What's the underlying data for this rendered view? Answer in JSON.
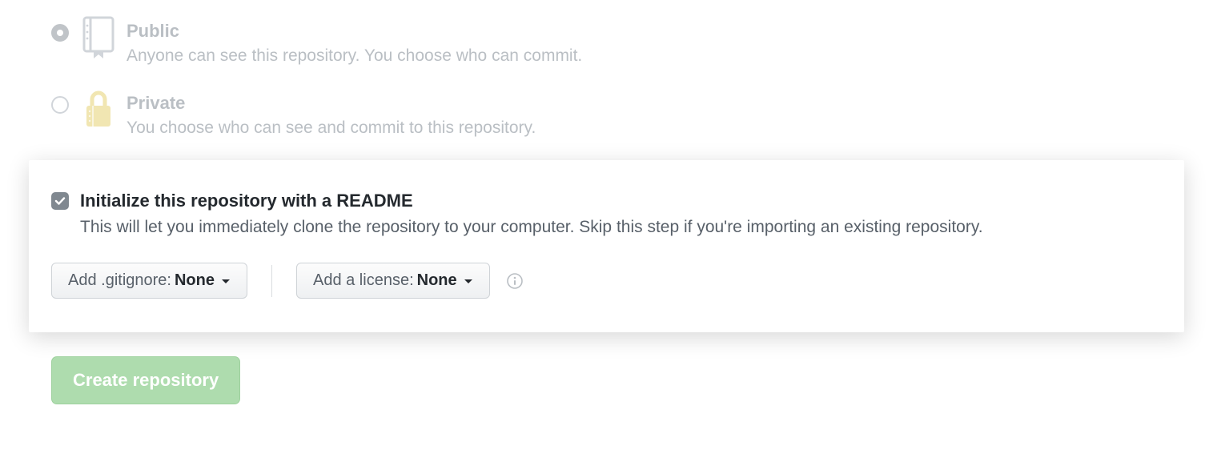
{
  "visibility": {
    "public": {
      "title": "Public",
      "desc": "Anyone can see this repository. You choose who can commit."
    },
    "private": {
      "title": "Private",
      "desc": "You choose who can see and commit to this repository."
    }
  },
  "readme": {
    "title": "Initialize this repository with a README",
    "desc": "This will let you immediately clone the repository to your computer. Skip this step if you're importing an existing repository."
  },
  "gitignore": {
    "label": "Add .gitignore:",
    "value": "None"
  },
  "license": {
    "label": "Add a license:",
    "value": "None"
  },
  "submit": {
    "label": "Create repository"
  }
}
